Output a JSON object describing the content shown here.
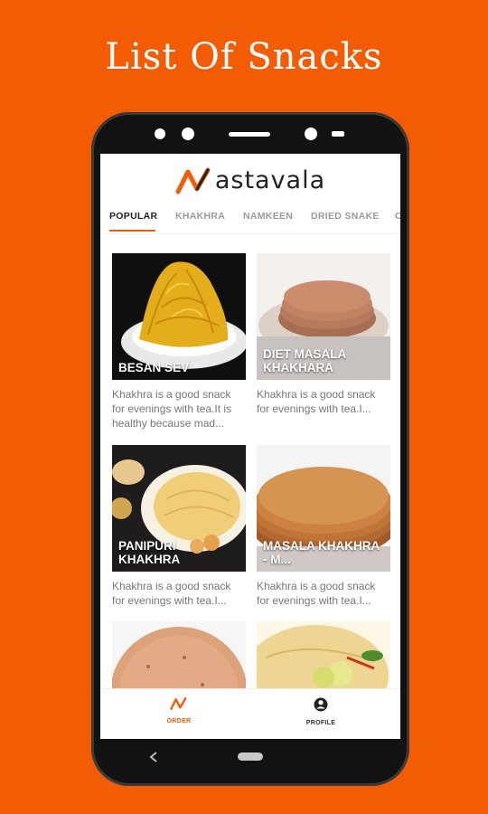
{
  "headline": "List Of  Snacks",
  "app": {
    "brand_name": "astavala",
    "brand_color": "#f25c05",
    "tabs": [
      {
        "label": "POPULAR",
        "active": true
      },
      {
        "label": "KHAKHRA"
      },
      {
        "label": "NAMKEEN"
      },
      {
        "label": "DRIED SNAKE"
      },
      {
        "label": "C"
      }
    ],
    "cards": [
      {
        "title": "BESAN SEV",
        "desc": "Khakhra is a good snack for evenings with tea.It is healthy because mad..."
      },
      {
        "title": "DIET MASALA KHAKHARA",
        "desc": "Khakhra is a good snack for evenings with tea.I..."
      },
      {
        "title": "PANIPURI KHAKHRA",
        "desc": "Khakhra is a good snack for evenings with tea.I..."
      },
      {
        "title": "MASALA KHAKHRA - M...",
        "desc": "Khakhra is a good snack for evenings with tea.I..."
      },
      {
        "title": "",
        "desc": ""
      },
      {
        "title": "",
        "desc": ""
      }
    ],
    "bottom_nav": [
      {
        "label": "ORDER",
        "icon": "logo-n-icon",
        "active": true
      },
      {
        "label": "PROFILE",
        "icon": "account-circle-icon"
      }
    ]
  }
}
